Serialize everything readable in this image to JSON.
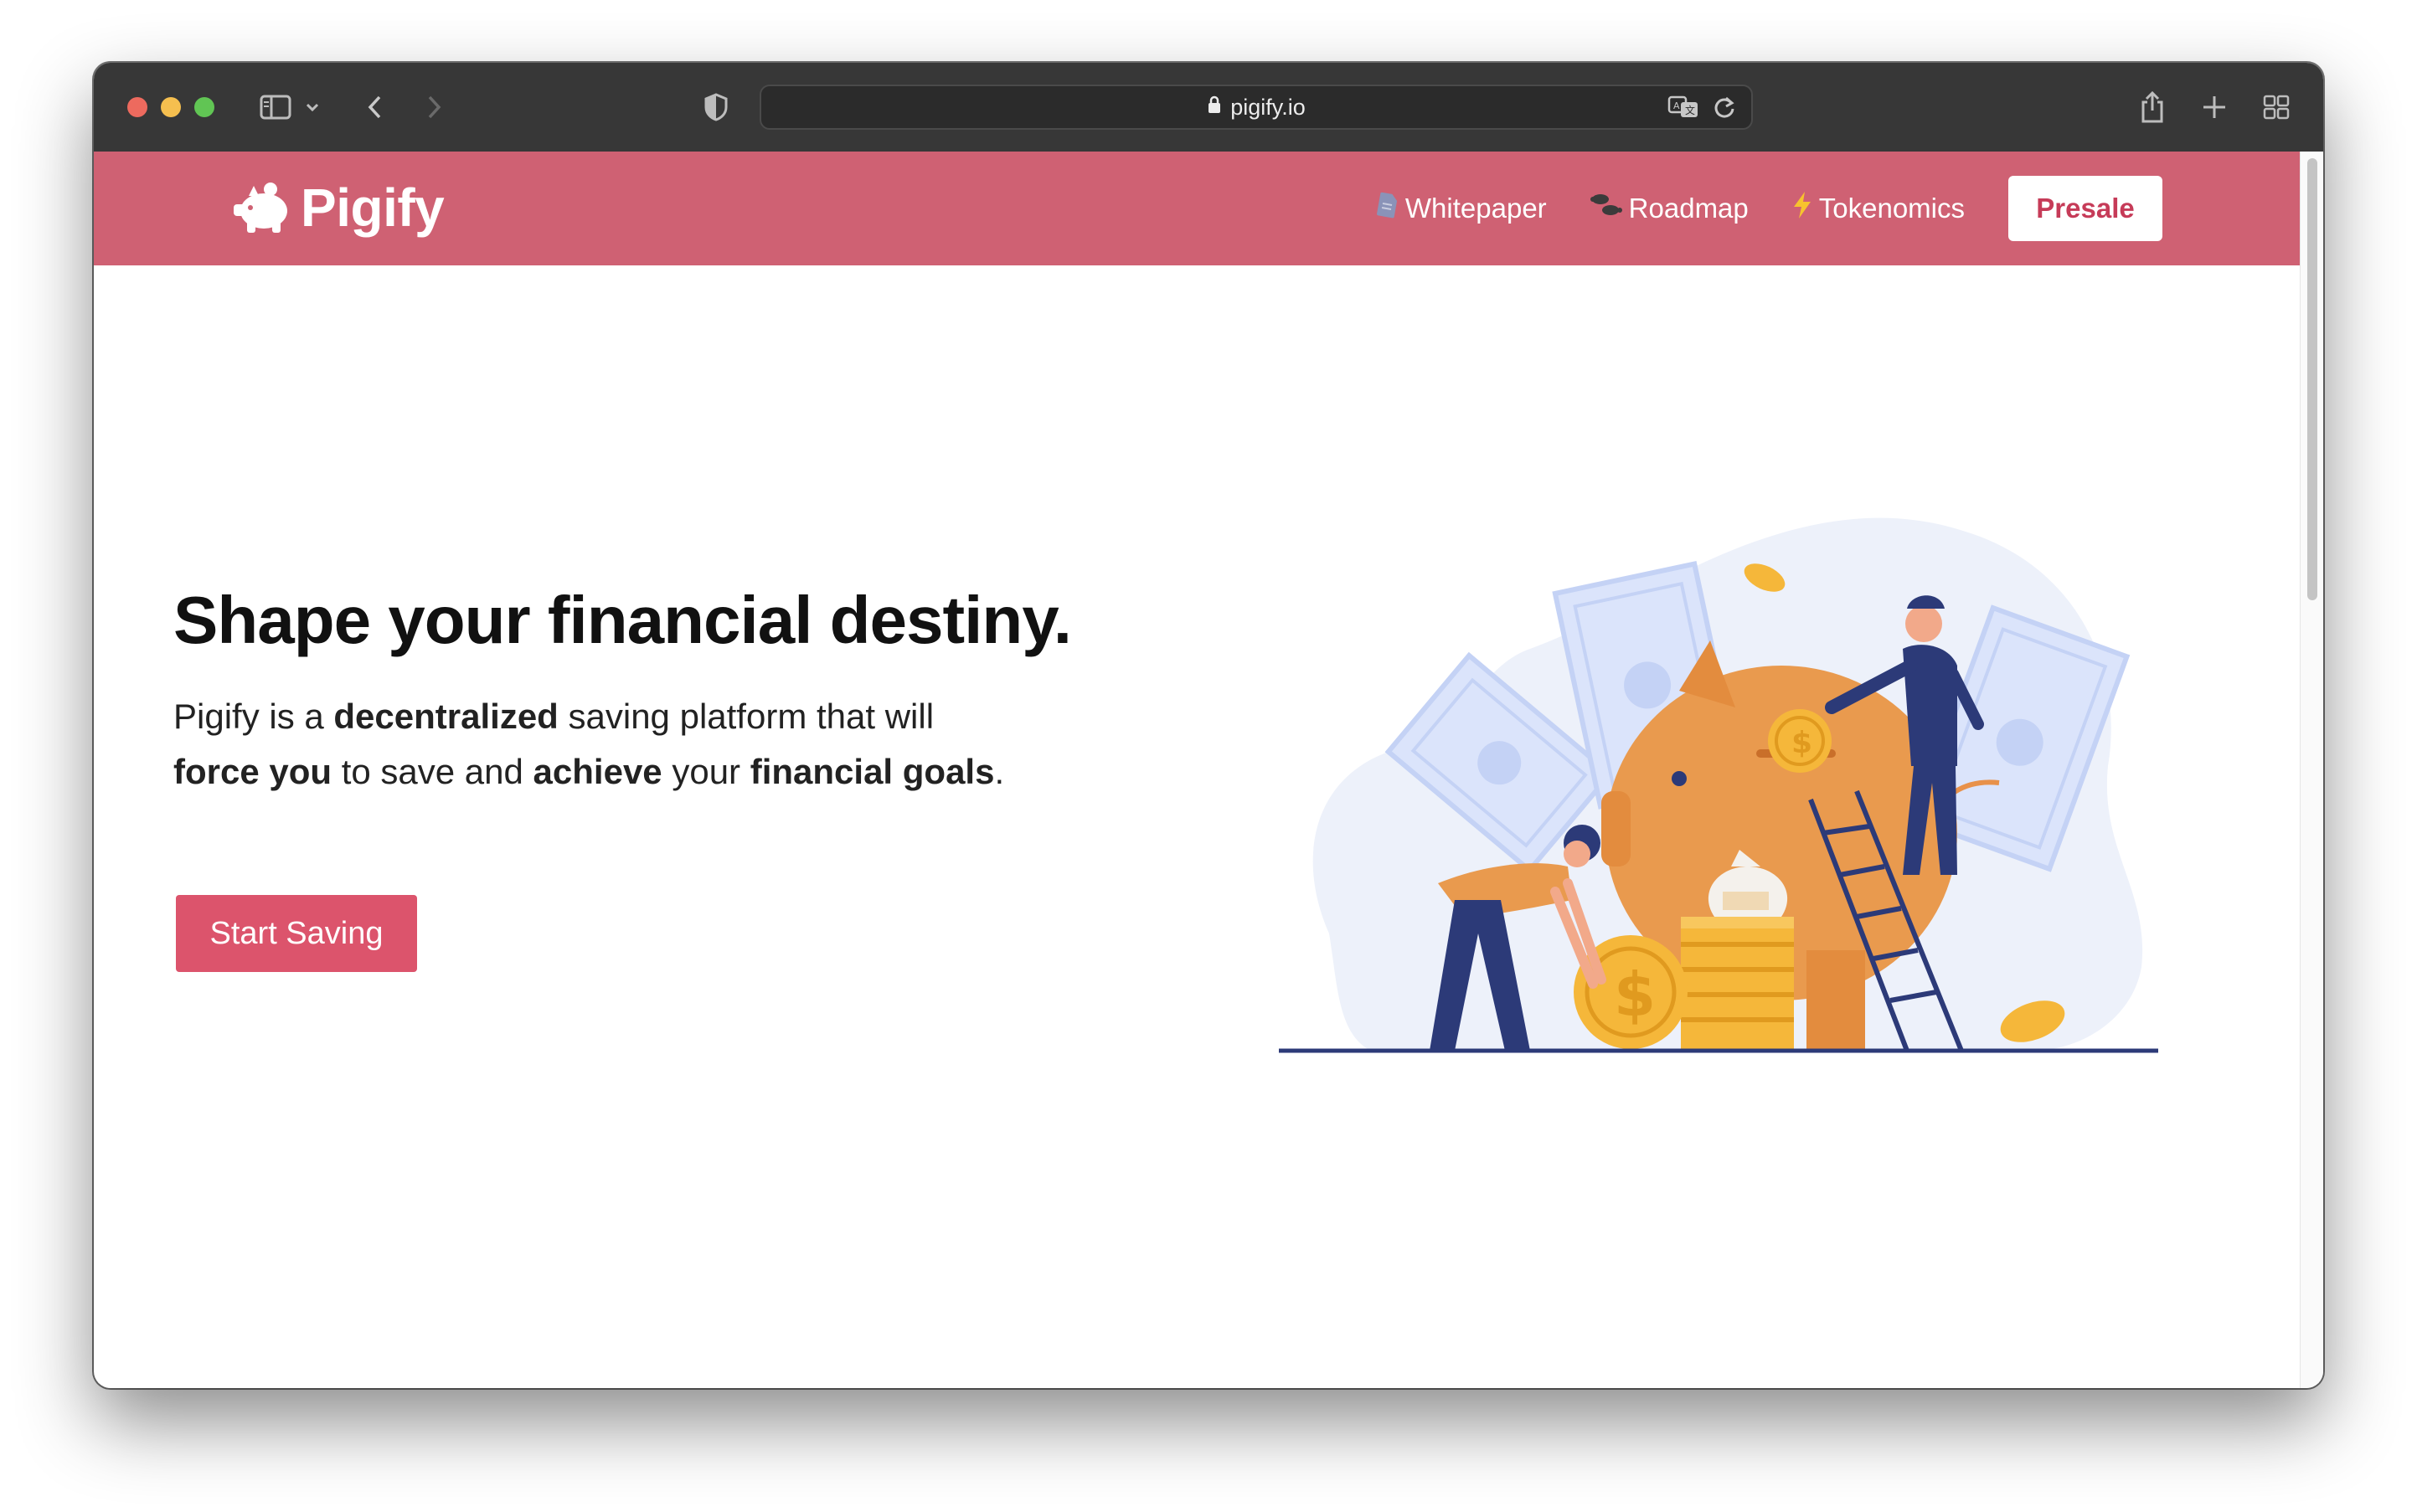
{
  "browser": {
    "url": "pigify.io",
    "icons": [
      "sidebar-icon",
      "chevron-down-icon",
      "back-icon",
      "forward-icon",
      "shield-icon",
      "lock-icon",
      "translate-icon",
      "reload-icon",
      "share-icon",
      "new-tab-icon",
      "tab-overview-icon"
    ]
  },
  "nav": {
    "brand": "Pigify",
    "links": [
      {
        "label": "Whitepaper",
        "icon": "document-icon"
      },
      {
        "label": "Roadmap",
        "icon": "footprints-icon"
      },
      {
        "label": "Tokenomics",
        "icon": "lightning-icon"
      }
    ],
    "presale": "Presale"
  },
  "hero": {
    "title": "Shape your financial destiny.",
    "text": {
      "p1": "Pigify is a ",
      "b1": "decentralized",
      "p2": " saving platform that will ",
      "b2": "force you",
      "p3": " to save and ",
      "b3": "achieve",
      "p4": " your ",
      "b4": "financial goals",
      "p5": "."
    },
    "cta": "Start Saving",
    "illustration": "piggy-bank-illustration"
  },
  "colors": {
    "navbar": "#cf6173",
    "cta": "#dc546c",
    "presale_text": "#c63b58"
  }
}
